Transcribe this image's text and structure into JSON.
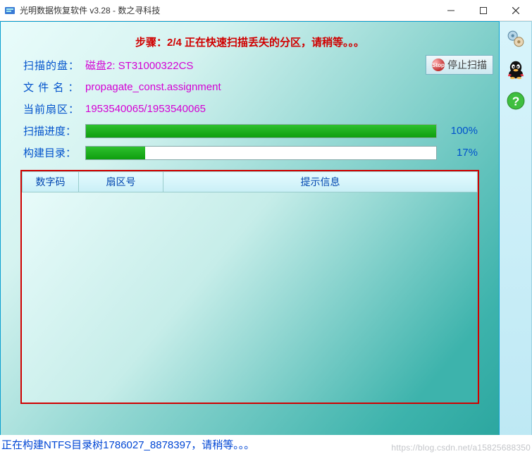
{
  "window": {
    "title": "光明数据恢复软件 v3.28 - 数之寻科技"
  },
  "step_message": "步骤：2/4 正在快速扫描丢失的分区，请稍等。。。",
  "stop_button": "停止扫描",
  "info": {
    "disk_label": "扫描的盘：",
    "disk_value": "磁盘2: ST31000322CS",
    "file_label": "文 件 名 ：",
    "file_value": "propagate_const.assignment",
    "sector_label": "当前扇区：",
    "sector_value": "1953540065/1953540065"
  },
  "progress": {
    "scan_label": "扫描进度：",
    "scan_pct_text": "100%",
    "scan_pct": 100,
    "build_label": "构建目录：",
    "build_pct_text": "17%",
    "build_pct": 17
  },
  "table": {
    "col1": "数字码",
    "col2": "扇区号",
    "col3": "提示信息"
  },
  "status": "正在构建NTFS目录树1786027_8878397，请稍等。。。",
  "watermark": "https://blog.csdn.net/a15825688350"
}
